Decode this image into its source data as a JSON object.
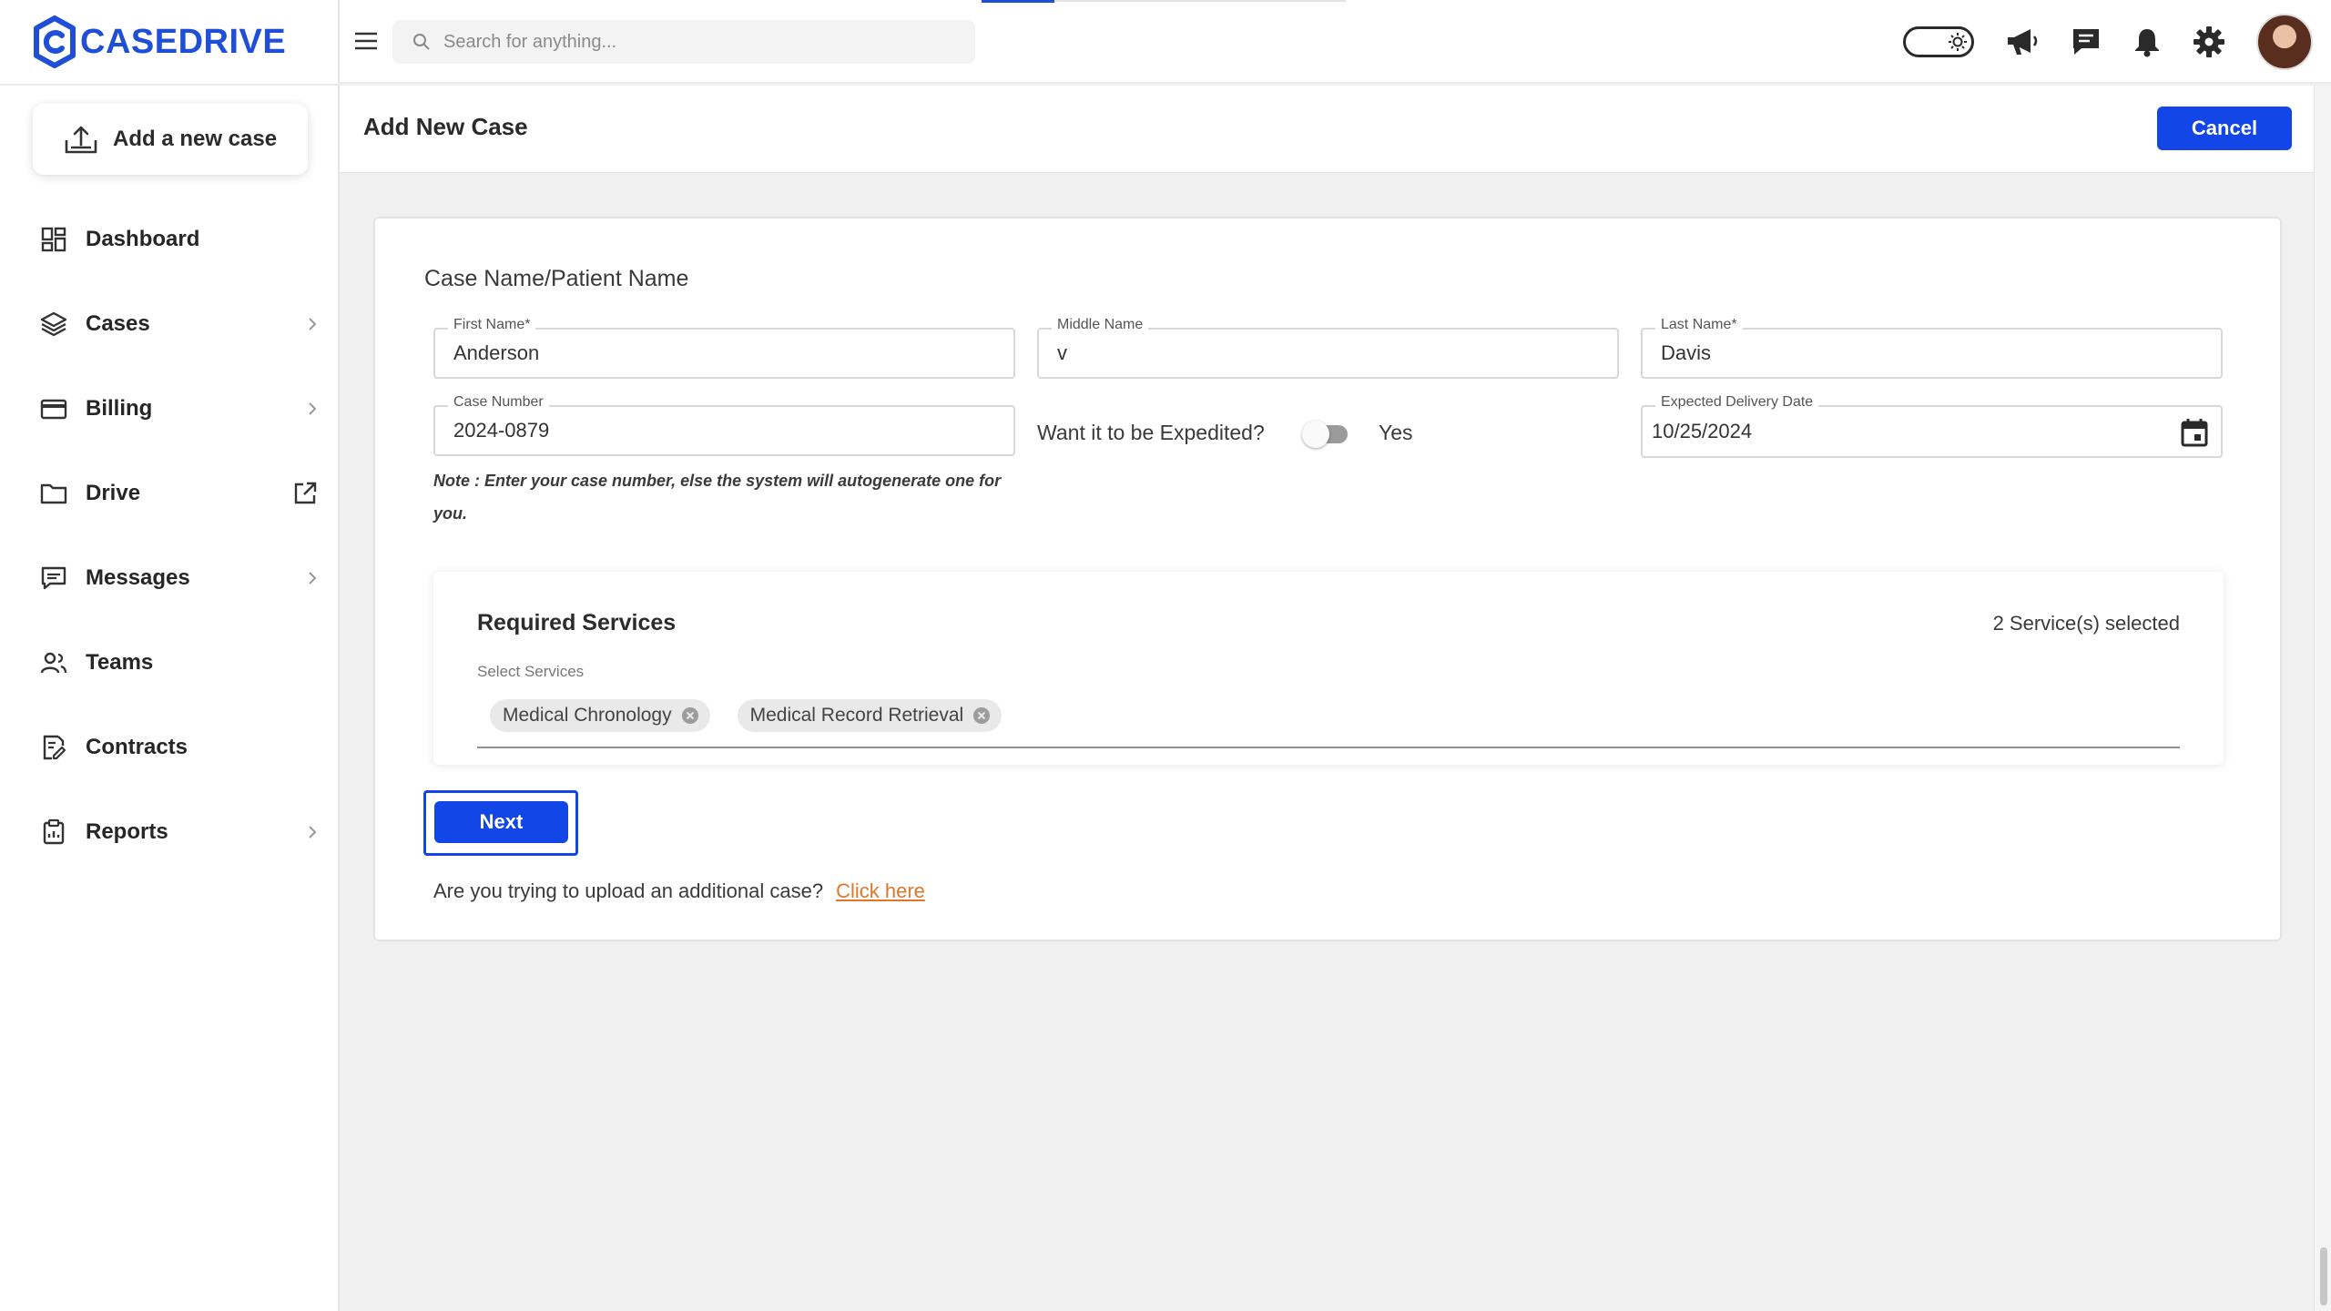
{
  "app": {
    "logo_text": "CASEDRIVE"
  },
  "sidebar": {
    "add_case_label": "Add a new case",
    "items": [
      {
        "label": "Dashboard"
      },
      {
        "label": "Cases"
      },
      {
        "label": "Billing"
      },
      {
        "label": "Drive"
      },
      {
        "label": "Messages"
      },
      {
        "label": "Teams"
      },
      {
        "label": "Contracts"
      },
      {
        "label": "Reports"
      }
    ]
  },
  "header": {
    "search_placeholder": "Search for anything..."
  },
  "page": {
    "title": "Add New Case",
    "cancel_label": "Cancel"
  },
  "form": {
    "section_title": "Case Name/Patient Name",
    "first_name": {
      "label": "First Name*",
      "value": "Anderson"
    },
    "middle_name": {
      "label": "Middle Name",
      "value": "v"
    },
    "last_name": {
      "label": "Last Name*",
      "value": "Davis"
    },
    "case_number": {
      "label": "Case Number",
      "value": "2024-0879"
    },
    "note": "Note : Enter your case number, else the system will autogenerate one for you.",
    "expedite_question": "Want it to be Expedited?",
    "expedite_yes": "Yes",
    "expedite_on": false,
    "delivery_date": {
      "label": "Expected Delivery Date",
      "value": "10/25/2024"
    }
  },
  "services": {
    "title": "Required Services",
    "count_text": "2 Service(s) selected",
    "subtitle": "Select Services",
    "selected": [
      {
        "label": "Medical Chronology"
      },
      {
        "label": "Medical Record Retrieval"
      }
    ]
  },
  "actions": {
    "next_label": "Next",
    "upload_question": "Are you trying to upload an additional case?",
    "click_here": "Click here"
  },
  "colors": {
    "brand": "#1f4fd6",
    "primary_button": "#1346e6",
    "link": "#e0762a"
  }
}
